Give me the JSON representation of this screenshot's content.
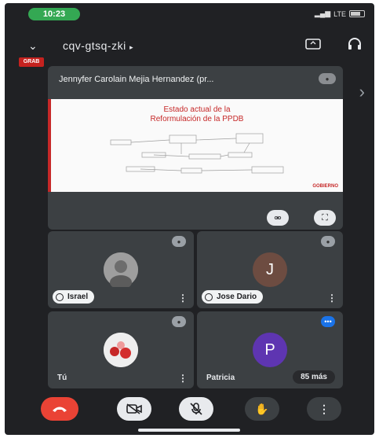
{
  "status_bar": {
    "time": "10:23",
    "network": "LTE",
    "battery_label": ""
  },
  "header": {
    "meeting_code": "cqv-gtsq-zki",
    "rec_badge": "GRAB",
    "icons": [
      "chevron-down-icon",
      "camera-switch-icon",
      "headphones-icon"
    ]
  },
  "presenter": {
    "name": "Jennyfer Carolain Mejia Hernandez (pr...",
    "slide_title_line1": "Estado actual de la",
    "slide_title_line2": "Reformulación de la PPDB",
    "slide_logo": "GOBIERNO"
  },
  "participants": [
    {
      "name": "Israel",
      "avatar_letter": "",
      "avatar_color": "#8d8d8d",
      "muted": true
    },
    {
      "name": "Jose Dario",
      "avatar_letter": "J",
      "avatar_color": "#6d4c41",
      "muted": true
    },
    {
      "name": "Tú",
      "avatar_letter": "",
      "avatar_color": "#e0e0e0",
      "muted": true
    },
    {
      "name": "Patricia",
      "avatar_letter": "P",
      "avatar_color": "#5e35b1",
      "muted": false
    }
  ],
  "more_participants": "85 más",
  "controls": [
    "end-call-icon",
    "camera-off-icon",
    "mic-off-icon",
    "raise-hand-icon",
    "more-options-icon"
  ],
  "colors": {
    "end_call": "#ea4335",
    "accent": "#1a73e8",
    "background": "#202124",
    "tile": "#3c4043"
  }
}
